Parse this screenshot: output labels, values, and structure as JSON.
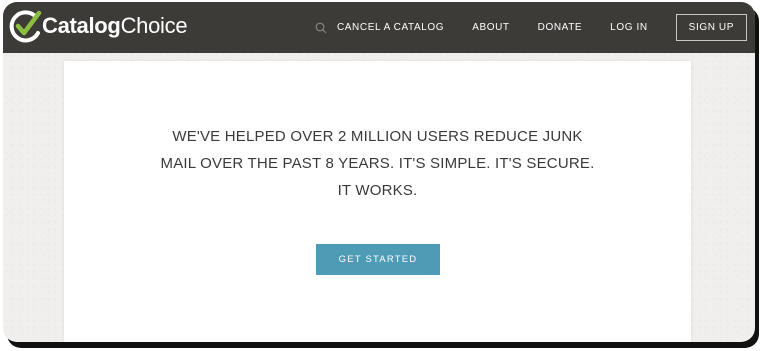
{
  "header": {
    "logo": {
      "prefix": "Catalog",
      "suffix": "Choice"
    },
    "nav": {
      "cancel_label": "CANCEL A CATALOG",
      "about_label": "ABOUT",
      "donate_label": "DONATE",
      "login_label": "LOG IN",
      "signup_label": "SIGN UP"
    }
  },
  "main": {
    "headline_lines": [
      "WE'VE HELPED OVER 2 MILLION USERS REDUCE JUNK",
      "MAIL OVER THE PAST 8 YEARS. IT'S SIMPLE. IT'S SECURE.",
      "IT WORKS."
    ],
    "cta_label": "GET STARTED"
  },
  "colors": {
    "navbar": "#3d3b37",
    "accent": "#4e9bb5",
    "logo_check": "#8cbf3f"
  }
}
